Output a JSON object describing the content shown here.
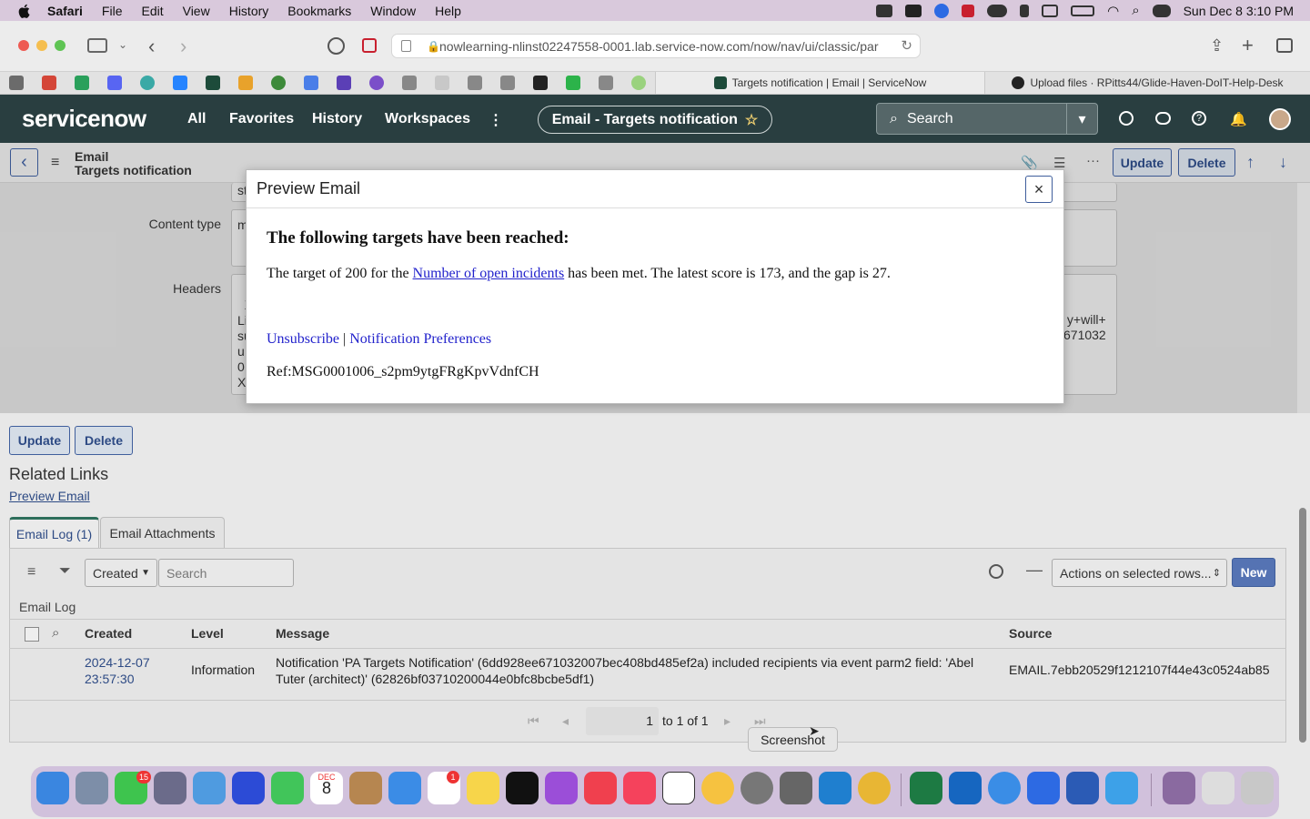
{
  "menubar": {
    "items": [
      "Safari",
      "File",
      "Edit",
      "View",
      "History",
      "Bookmarks",
      "Window",
      "Help"
    ],
    "clock": "Sun Dec 8  3:10 PM"
  },
  "browser": {
    "url": "nowlearning-nlinst02247558-0001.lab.service-now.com/now/nav/ui/classic/par",
    "tabs": [
      {
        "title": "Targets notification | Email | ServiceNow"
      },
      {
        "title": "Upload files · RPitts44/Glide-Haven-DoIT-Help-Desk"
      }
    ]
  },
  "sn_header": {
    "logo": "servicenow",
    "nav": [
      "All",
      "Favorites",
      "History",
      "Workspaces"
    ],
    "context_pill": "Email - Targets notification",
    "search_placeholder": "Search"
  },
  "form_header": {
    "table": "Email",
    "record": "Targets notification",
    "update_label": "Update",
    "delete_label": "Delete"
  },
  "form_fields": {
    "content_type_label": "Content type",
    "content_type_value": "m",
    "headers_label": "Headers",
    "headers_left": "X\nLi\nsu\nu\n0\nX",
    "headers_right": "y+will+\n671032",
    "top_fragment": "st"
  },
  "modal": {
    "title": "Preview Email",
    "close": "×",
    "heading": "The following targets have been reached:",
    "body_pre": "The target of 200 for the ",
    "body_link": "Number of open incidents",
    "body_post": " has been met. The latest score is 173, and the gap is 27.",
    "unsubscribe": "Unsubscribe",
    "separator": " | ",
    "preferences": "Notification Preferences",
    "ref": "Ref:MSG0001006_s2pm9ytgFRgKpvVdnfCH"
  },
  "bottom_buttons": {
    "update_label": "Update",
    "delete_label": "Delete"
  },
  "related_links": {
    "title": "Related Links",
    "preview": "Preview Email"
  },
  "related_tabs": [
    "Email Log (1)",
    "Email Attachments"
  ],
  "list": {
    "filter_field": "Created",
    "search_placeholder": "Search",
    "actions": "Actions on selected rows...",
    "new_label": "New",
    "title": "Email Log",
    "columns": [
      "Created",
      "Level",
      "Message",
      "Source"
    ],
    "rows": [
      {
        "created": "2024-12-07 23:57:30",
        "level": "Information",
        "message": "Notification 'PA Targets Notification' (6dd928ee671032007bec408bd485ef2a) included recipients via event parm2 field: 'Abel Tuter (architect)' (62826bf03710200044e0bfc8bcbe5df1)",
        "source": "EMAIL.7ebb20529f1212107f44e43c0524ab85"
      }
    ],
    "pagination": {
      "page": "1",
      "of": "to 1 of 1"
    }
  },
  "dock": {
    "tooltip": "Screenshot",
    "calendar_month": "DEC",
    "calendar_day": "8",
    "messages_badge": "15",
    "reminders_badge": "1"
  }
}
